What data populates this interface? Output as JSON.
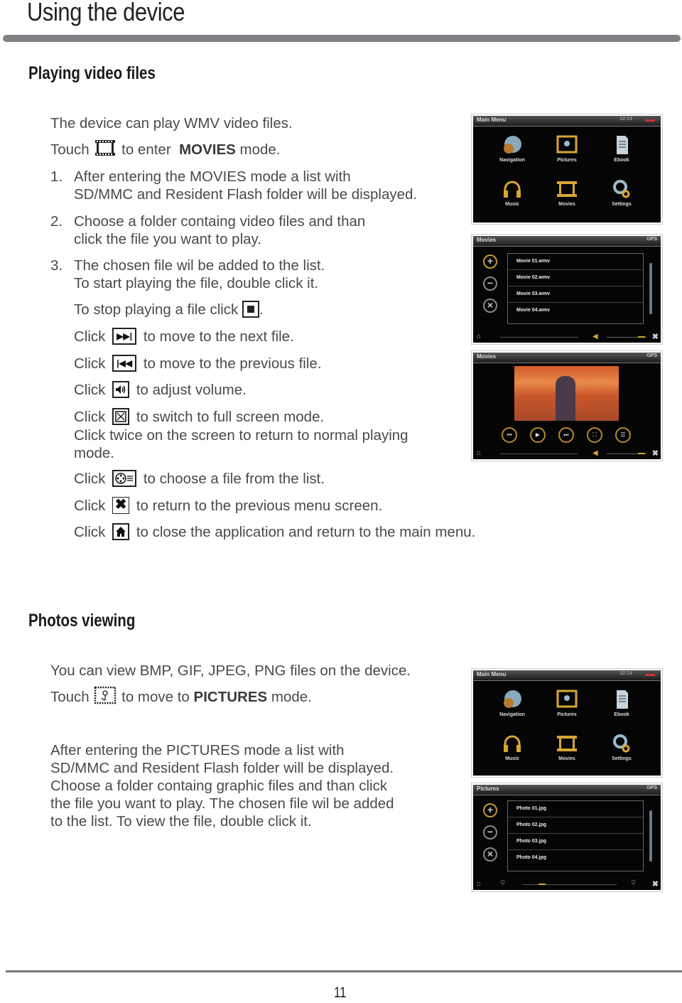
{
  "page": {
    "title": "Using the device",
    "page_number": "11"
  },
  "video_section": {
    "heading": "Playing video files",
    "intro": "The device can play WMV video files.",
    "touch_prefix": "Touch",
    "touch_middle": "to enter",
    "touch_mode": "MOVIES",
    "touch_suffix": "mode.",
    "steps": [
      {
        "num": "1.",
        "line1": "After entering the MOVIES mode a list with",
        "line2": "SD/MMC and Resident Flash folder will be displayed."
      },
      {
        "num": "2.",
        "line1": "Choose a folder containg video files and than",
        "line2": "click the file you want to play."
      },
      {
        "num": "3.",
        "line1": "The chosen file wil be added to the list.",
        "line2": "To start playing the file, double click it."
      }
    ],
    "stop_text": "To stop playing  a file click",
    "stop_suffix": ".",
    "click_word": "Click",
    "instructions": [
      {
        "icon": "next-track-icon",
        "text": "to move to the next file."
      },
      {
        "icon": "previous-track-icon",
        "text": "to move to the previous  file."
      },
      {
        "icon": "volume-icon",
        "text": "to adjust volume."
      },
      {
        "icon": "fullscreen-icon",
        "text": "to switch to full screen mode."
      },
      {
        "icon": "file-list-icon",
        "text": "to choose a file from the list."
      },
      {
        "icon": "close-icon",
        "text": "to return to the previous menu screen."
      },
      {
        "icon": "home-icon",
        "text": "to close the application and return to the main menu."
      }
    ],
    "fullscreen_note_line1": "Click twice on the screen to return to normal playing",
    "fullscreen_note_line2": "mode."
  },
  "photo_section": {
    "heading": "Photos viewing",
    "intro": "You can view BMP, GIF, JPEG, PNG files on the device.",
    "touch_prefix": "Touch",
    "touch_middle": "to move to",
    "touch_mode": "PICTURES",
    "touch_suffix": "mode.",
    "paragraph": [
      "After entering the PICTURES mode a list with",
      "SD/MMC and Resident Flash folder will be displayed.",
      "Choose a folder containg graphic files and than click",
      "the file you want to play. The chosen file wil be added",
      "to the list. To view the file, double click it."
    ]
  },
  "screens": {
    "main_menu": {
      "title": "Main Menu",
      "status": "12:14",
      "items": [
        "Navigation",
        "Pictures",
        "Ebook",
        "Music",
        "Movies",
        "Settings"
      ]
    },
    "movies_list": {
      "title": "Movies",
      "status": "GPS",
      "files": [
        "Movie 01.wmv",
        "Movie 02.wmv",
        "Movie 03.wmv",
        "Movie 04.wmv"
      ],
      "side_buttons": [
        "+",
        "−",
        "×"
      ]
    },
    "movies_player": {
      "title": "Movies",
      "status": "GPS",
      "controls": [
        "⏮",
        "▶",
        "⏭",
        "⛶",
        "☰"
      ]
    },
    "pictures_list": {
      "title": "Pictures",
      "status": "GPS",
      "files": [
        "Photo 01.jpg",
        "Photo 02.jpg",
        "Photo 03.jpg",
        "Photo 04.jpg"
      ],
      "side_buttons": [
        "+",
        "−",
        "×"
      ]
    }
  },
  "colors": {
    "accent_gold": "#c8962e",
    "rule_gray": "#808084"
  }
}
